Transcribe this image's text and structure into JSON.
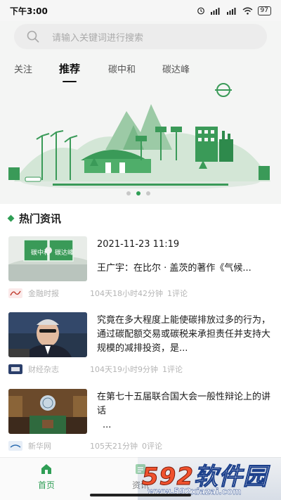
{
  "status_bar": {
    "time": "下午3:00",
    "battery": "97"
  },
  "search": {
    "placeholder": "请输入关键词进行搜索"
  },
  "tabs": [
    {
      "label": "关注"
    },
    {
      "label": "推荐",
      "active": true
    },
    {
      "label": "碳中和"
    },
    {
      "label": "碳达峰"
    }
  ],
  "banner": {
    "slide_count": 3,
    "active_slide": 2
  },
  "section": {
    "title": "热门资讯"
  },
  "news": [
    {
      "date": "2021-11-23 11:19",
      "title": "王广宇：在比尔 · 盖茨的著作《气候...",
      "source": "金融时报",
      "time": "104天18小时42分钟",
      "comments": "1评论",
      "thumb_words": [
        "碳中和",
        "碳达峰"
      ]
    },
    {
      "title": "究竟在多大程度上能使碳排放过多的行为，通过碳配额交易或碳税来承担责任并支持大规模的减排投资，是...",
      "source": "财经杂志",
      "time": "104天19小时9分钟",
      "comments": "1评论"
    },
    {
      "title": "在第七十五届联合国大会一般性辩论上的讲话",
      "title_extra": "...",
      "source": "新华网",
      "time": "105天21分钟",
      "comments": "0评论"
    }
  ],
  "bottom_nav": [
    {
      "label": "首页",
      "active": true,
      "icon": "home-icon"
    },
    {
      "label": "资讯",
      "icon": "news-icon"
    }
  ],
  "watermark": {
    "logo_prefix": "592",
    "logo_suffix": "软件园",
    "url": "www.592xiazai.com"
  },
  "colors": {
    "accent": "#2f9e55",
    "banner_green": "#3a9a58",
    "muted": "#b5b5b5"
  }
}
